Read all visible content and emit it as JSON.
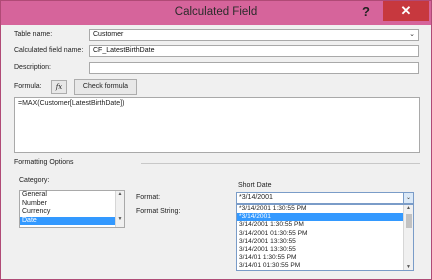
{
  "window": {
    "title": "Calculated Field",
    "help": "?",
    "close": "✕"
  },
  "fields": {
    "table_name_label": "Table name:",
    "table_name_value": "Customer",
    "calc_name_label": "Calculated field name:",
    "calc_name_value": "CF_LatestBirthDate",
    "description_label": "Description:",
    "description_value": ""
  },
  "formula": {
    "label": "Formula:",
    "fx": "fx",
    "check_label": "Check formula",
    "text": "=MAX(Customer[LatestBirthDate])"
  },
  "formatting": {
    "section_label": "Formatting Options",
    "category_label": "Category:",
    "categories": [
      {
        "label": "General"
      },
      {
        "label": "Number"
      },
      {
        "label": "Currency"
      },
      {
        "label": "Date",
        "selected": true
      }
    ],
    "format_header": "Short Date",
    "format_label": "Format:",
    "format_value": "*3/14/2001",
    "format_string_label": "Format String:",
    "format_options": [
      {
        "label": "*3/14/2001 1:30:55 PM"
      },
      {
        "label": "*3/14/2001",
        "selected": true
      },
      {
        "label": "3/14/2001 1:30:55 PM"
      },
      {
        "label": "3/14/2001 01:30:55 PM"
      },
      {
        "label": "3/14/2001 13:30:55"
      },
      {
        "label": "3/14/2001 13:30:55"
      },
      {
        "label": "3/14/01 1:30:55 PM"
      },
      {
        "label": "3/14/01 01:30:55 PM"
      }
    ]
  },
  "colors": {
    "title_bar": "#d6649b",
    "close": "#c7383e",
    "selection": "#3399ff"
  },
  "icons": {
    "help": "question-icon",
    "close": "close-icon",
    "dropdown": "chevron-down-icon"
  }
}
